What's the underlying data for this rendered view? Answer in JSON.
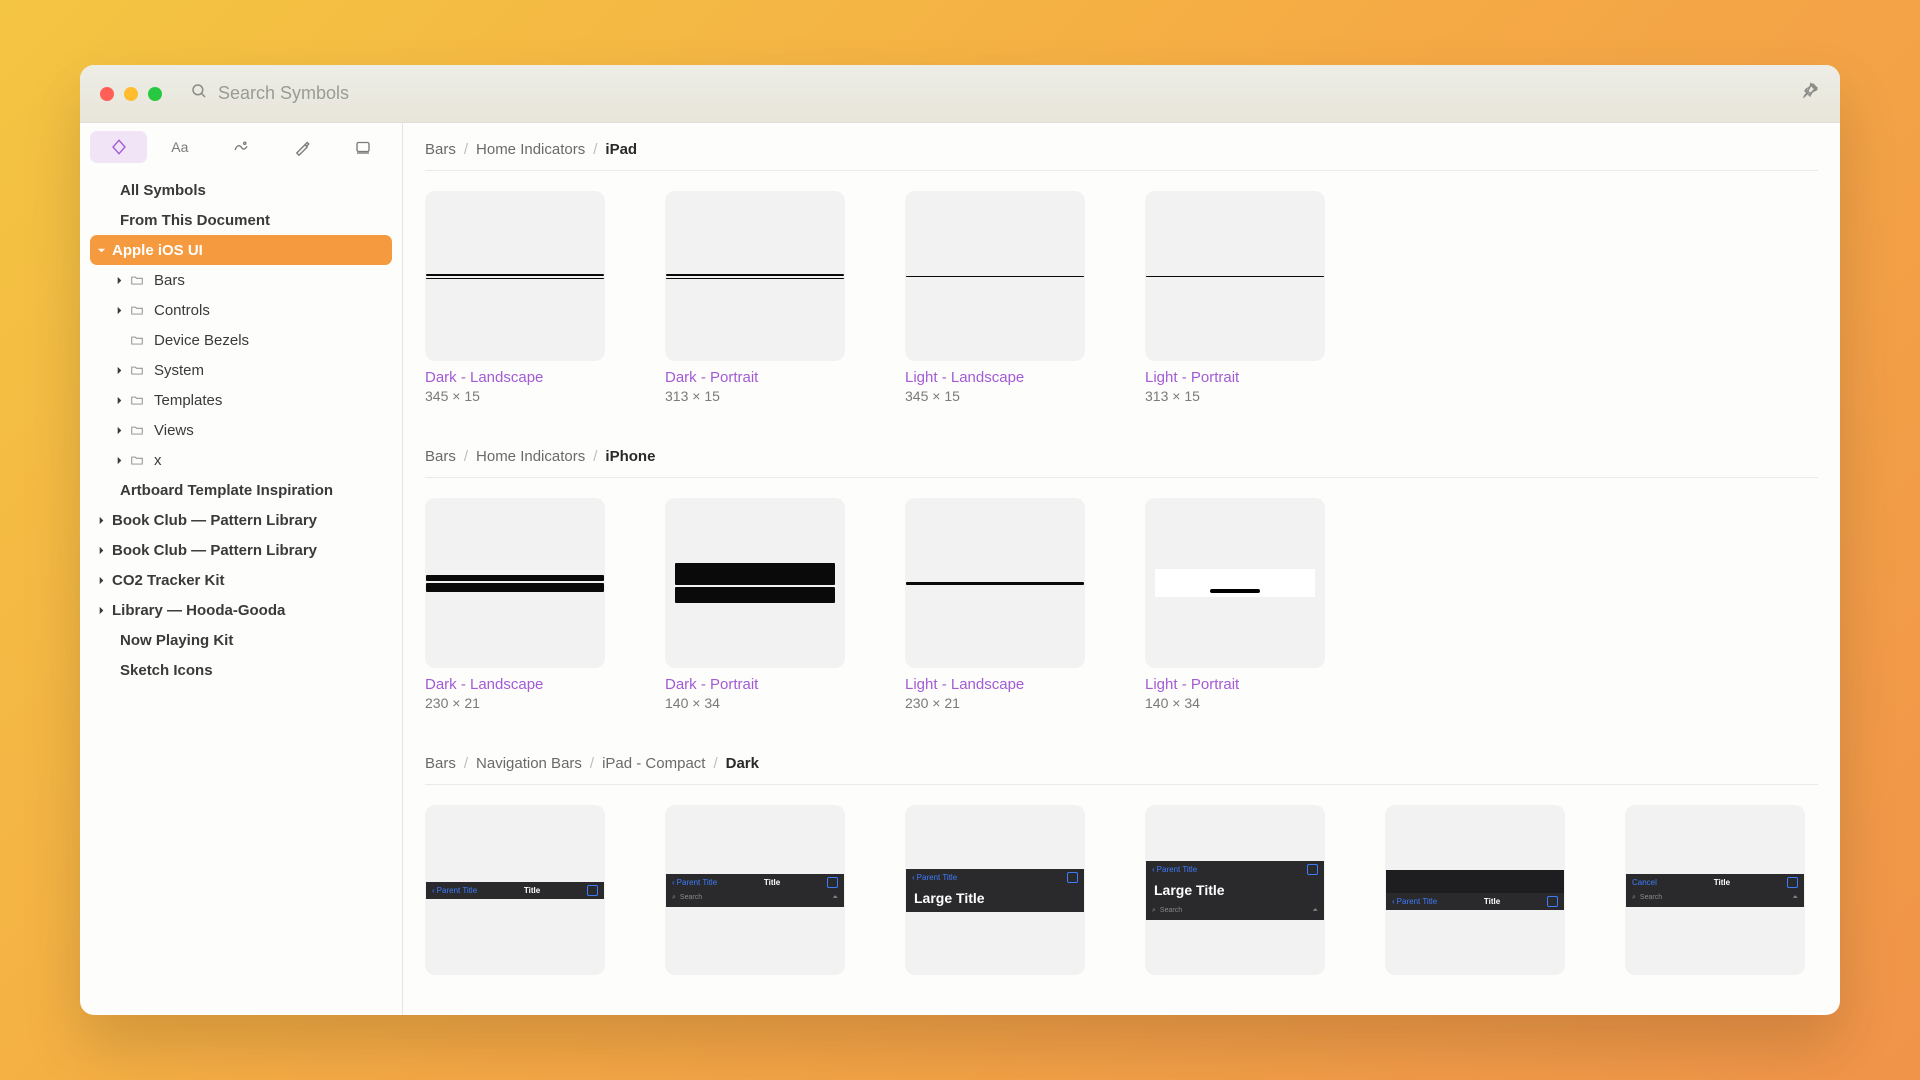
{
  "search": {
    "placeholder": "Search Symbols"
  },
  "sidebar": {
    "all": "All Symbols",
    "from_doc": "From This Document",
    "apple": "Apple iOS UI",
    "bars": "Bars",
    "controls": "Controls",
    "bezels": "Device Bezels",
    "system": "System",
    "templates": "Templates",
    "views": "Views",
    "x": "x",
    "artboard": "Artboard Template Inspiration",
    "bookclub1": "Book Club — Pattern Library",
    "bookclub2": "Book Club — Pattern Library",
    "co2": "CO2 Tracker Kit",
    "hooda": "Library — Hooda-Gooda",
    "nowplaying": "Now Playing Kit",
    "sketch": "Sketch Icons"
  },
  "sections": {
    "ipad": {
      "crumbs": [
        "Bars",
        "Home Indicators",
        "iPad"
      ]
    },
    "iphone": {
      "crumbs": [
        "Bars",
        "Home Indicators",
        "iPhone"
      ]
    },
    "navdark": {
      "crumbs": [
        "Bars",
        "Navigation Bars",
        "iPad - Compact",
        "Dark"
      ]
    }
  },
  "ipad_cards": [
    {
      "name": "Dark - Landscape",
      "dims": "345 × 15"
    },
    {
      "name": "Dark - Portrait",
      "dims": "313 × 15"
    },
    {
      "name": "Light - Landscape",
      "dims": "345 × 15"
    },
    {
      "name": "Light - Portrait",
      "dims": "313 × 15"
    }
  ],
  "iphone_cards": [
    {
      "name": "Dark - Landscape",
      "dims": "230 × 21"
    },
    {
      "name": "Dark - Portrait",
      "dims": "140 × 34"
    },
    {
      "name": "Light - Landscape",
      "dims": "230 × 21"
    },
    {
      "name": "Light - Portrait",
      "dims": "140 × 34"
    }
  ],
  "nb": {
    "parent": "Parent Title",
    "title": "Title",
    "large": "Large Title",
    "search": "Search",
    "cancel": "Cancel"
  }
}
